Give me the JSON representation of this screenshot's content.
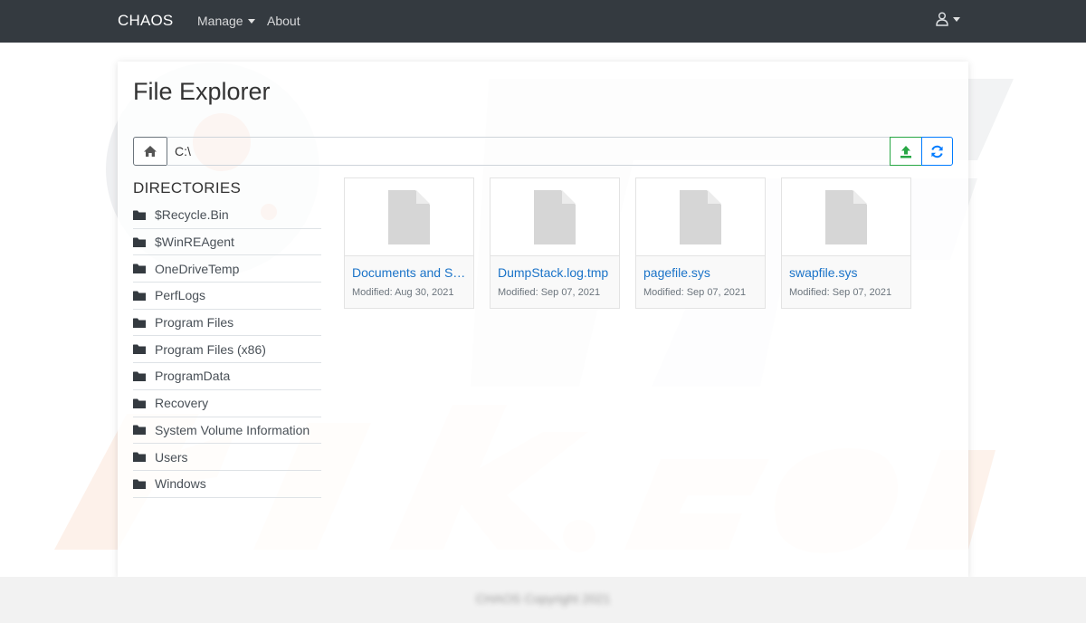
{
  "navbar": {
    "brand": "CHAOS",
    "manage_label": "Manage",
    "about_label": "About",
    "user_icon": "user-icon"
  },
  "page": {
    "title": "File Explorer"
  },
  "pathbar": {
    "path_value": "C:\\",
    "home_icon": "home-icon",
    "upload_icon": "upload-icon",
    "refresh_icon": "refresh-icon"
  },
  "directories": {
    "heading": "DIRECTORIES",
    "items": [
      {
        "label": "$Recycle.Bin"
      },
      {
        "label": "$WinREAgent"
      },
      {
        "label": "OneDriveTemp"
      },
      {
        "label": "PerfLogs"
      },
      {
        "label": "Program Files"
      },
      {
        "label": "Program Files (x86)"
      },
      {
        "label": "ProgramData"
      },
      {
        "label": "Recovery"
      },
      {
        "label": "System Volume Information"
      },
      {
        "label": "Users"
      },
      {
        "label": "Windows"
      }
    ]
  },
  "files": [
    {
      "name": "Documents and Settings",
      "modified": "Modified: Aug 30, 2021"
    },
    {
      "name": "DumpStack.log.tmp",
      "modified": "Modified: Sep 07, 2021"
    },
    {
      "name": "pagefile.sys",
      "modified": "Modified: Sep 07, 2021"
    },
    {
      "name": "swapfile.sys",
      "modified": "Modified: Sep 07, 2021"
    }
  ],
  "footer": {
    "text": "CHAOS Copyright 2021"
  },
  "colors": {
    "navbar_bg": "#343a40",
    "link": "#1a73c8",
    "upload_green": "#28a745",
    "refresh_blue": "#007bff"
  }
}
